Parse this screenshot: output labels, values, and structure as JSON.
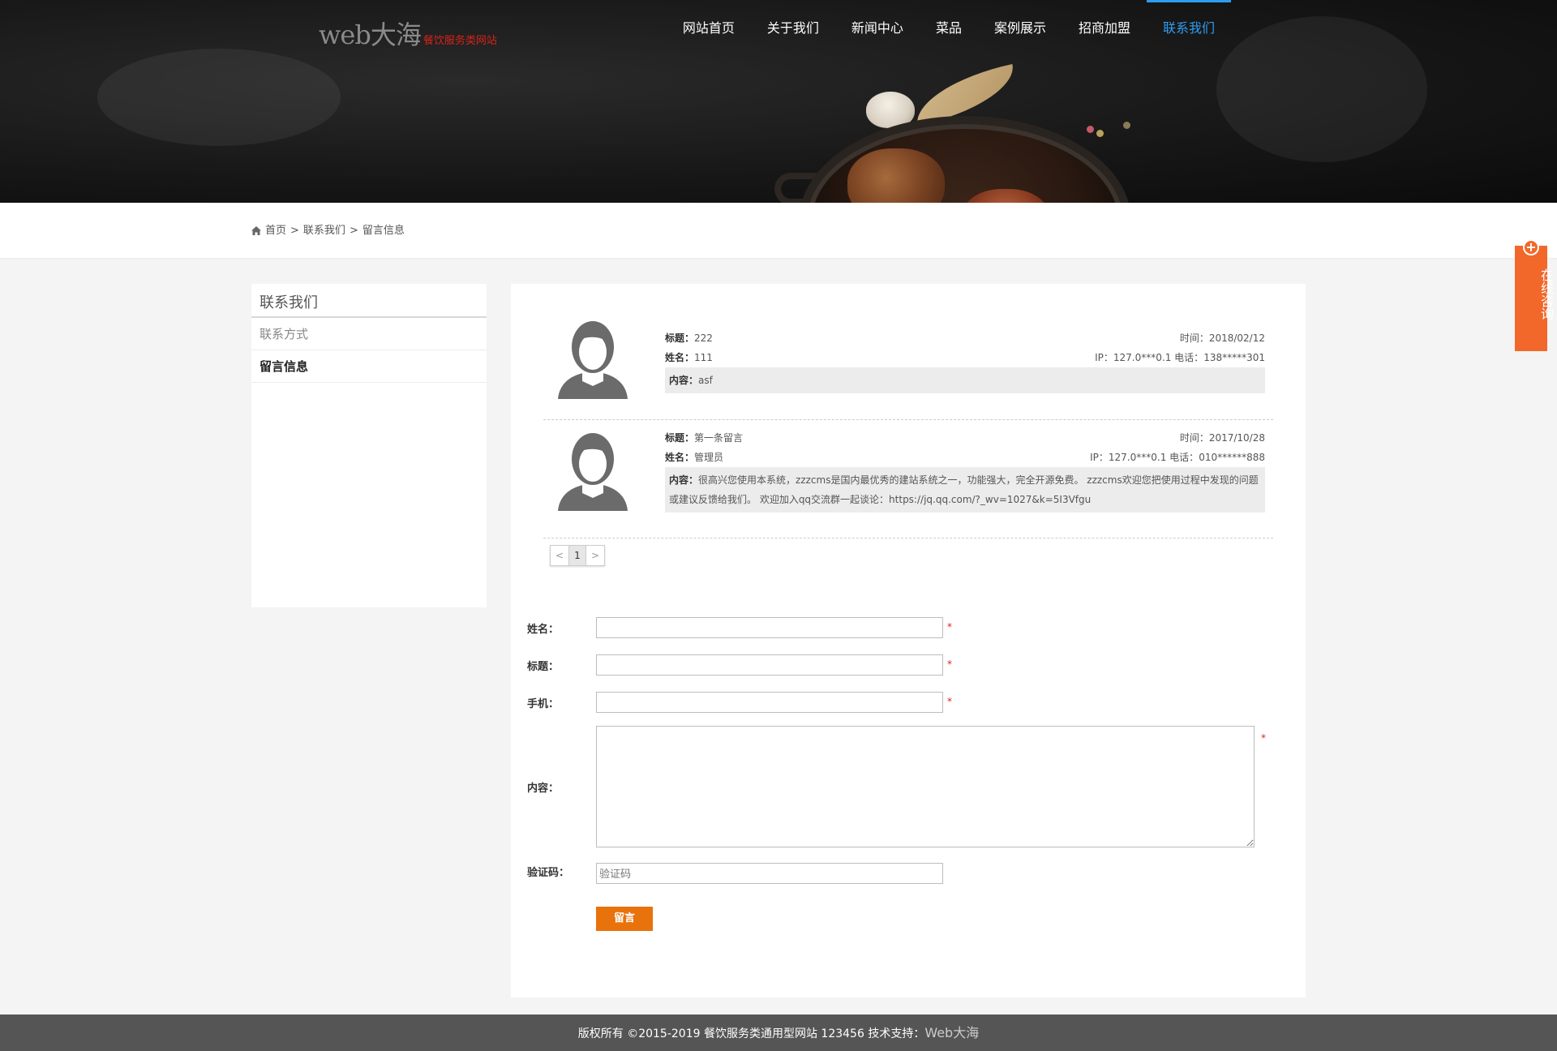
{
  "header": {
    "logo_main": "web大海",
    "logo_sub": "餐饮服务类网站",
    "nav": [
      {
        "label": "网站首页"
      },
      {
        "label": "关于我们"
      },
      {
        "label": "新闻中心"
      },
      {
        "label": "菜品"
      },
      {
        "label": "案例展示"
      },
      {
        "label": "招商加盟"
      },
      {
        "label": "联系我们",
        "active": true
      }
    ]
  },
  "breadcrumb": {
    "home": "首页",
    "sep": ">",
    "level1": "联系我们",
    "level2": "留言信息"
  },
  "sidebar": {
    "title": "联系我们",
    "items": [
      {
        "label": "联系方式"
      },
      {
        "label": "留言信息",
        "active": true
      }
    ]
  },
  "messages": [
    {
      "title_label": "标题：",
      "title": "222",
      "time_label": "时间：",
      "time": "2018/02/12",
      "name_label": "姓名：",
      "name": "111",
      "ip_label": "IP：",
      "ip": "127.0***0.1",
      "phone_label": "电话：",
      "phone": "138*****301",
      "content_label": "内容：",
      "content": "asf"
    },
    {
      "title_label": "标题：",
      "title": "第一条留言",
      "time_label": "时间：",
      "time": "2017/10/28",
      "name_label": "姓名：",
      "name": "管理员",
      "ip_label": "IP：",
      "ip": "127.0***0.1",
      "phone_label": "电话：",
      "phone": "010******888",
      "content_label": "内容：",
      "content": "很高兴您使用本系统，zzzcms是国内最优秀的建站系统之一，功能强大，完全开源免费。 zzzcms欢迎您把使用过程中发现的问题或建议反馈给我们。 欢迎加入qq交流群一起谈论：https://jq.qq.com/?_wv=1027&k=5I3Vfgu"
    }
  ],
  "pager": {
    "prev": "<",
    "current": "1",
    "next": ">"
  },
  "form": {
    "name_label": "姓名：",
    "title_label": "标题：",
    "phone_label": "手机：",
    "content_label": "内容：",
    "captcha_label": "验证码：",
    "captcha_placeholder": "验证码",
    "required_mark": "*",
    "submit_label": "留言"
  },
  "float_consult": {
    "plus": "+",
    "label": "在线咨询"
  },
  "footer": {
    "text": "版权所有 ©2015-2019 餐饮服务类通用型网站 123456 技术支持：",
    "brand": "Web大海"
  },
  "colors": {
    "nav_active": "#2e9cf0",
    "required": "#e2231a",
    "submit": "#e8720c",
    "consult": "#f2682a",
    "footer_bg": "#555555"
  }
}
